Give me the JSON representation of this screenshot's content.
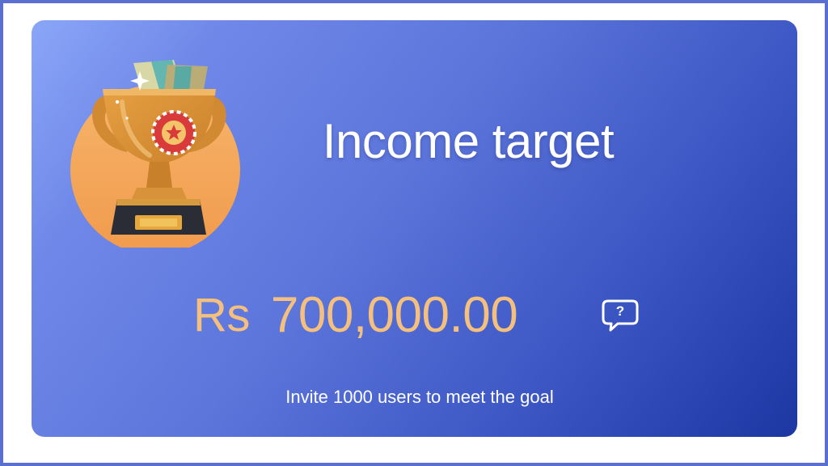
{
  "card": {
    "title": "Income target",
    "currency": "Rs",
    "amount": "700,000.00",
    "caption": "Invite 1000 users to meet the goal",
    "help_icon_glyph": "?"
  },
  "icons": {
    "trophy": "trophy-medal-icon",
    "help": "help-bubble-icon"
  },
  "colors": {
    "card_gradient_start": "#8aa6f8",
    "card_gradient_end": "#1c36a2",
    "amount": "#f5c07e",
    "title": "#ffffff",
    "trophy_circle": "#f2a35a",
    "frame_border": "#5a6fcf"
  }
}
